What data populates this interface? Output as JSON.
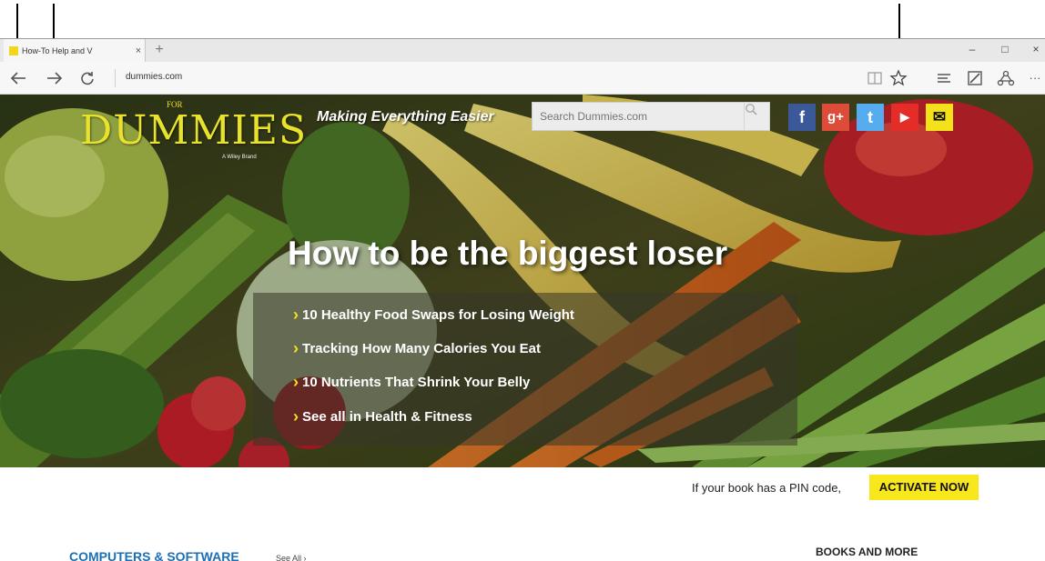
{
  "browser": {
    "tab_title": "How-To Help and V",
    "tab_close": "×",
    "new_tab": "+",
    "url": "dummies.com",
    "window_controls": [
      "–",
      "□",
      "×"
    ],
    "icons": [
      "back-icon",
      "forward-icon",
      "refresh-icon",
      "reading-view-icon",
      "favorites-star-icon",
      "hub-icon",
      "web-note-icon",
      "share-icon",
      "more-icon"
    ],
    "more_label": "···"
  },
  "site": {
    "logo_for": "FOR",
    "logo_main": "DUMMIES",
    "logo_wiley": "A Wiley Brand",
    "tagline": "Making Everything Easier",
    "search_placeholder": "Search Dummies.com",
    "social": [
      "f",
      "g+",
      "t",
      "▶",
      "✉"
    ],
    "social_names": [
      "facebook",
      "google-plus",
      "twitter",
      "youtube",
      "email"
    ]
  },
  "hero": {
    "headline": "How to be the biggest loser",
    "links": [
      "10 Healthy Food Swaps for Losing Weight",
      "Tracking How Many Calories You Eat",
      "10 Nutrients That Shrink Your Belly",
      "See all in Health & Fitness"
    ]
  },
  "pin": {
    "text": "If your book has a PIN code,",
    "button": "ACTIVATE NOW"
  },
  "sections": {
    "category_title": "COMPUTERS & SOFTWARE",
    "see_all": "See All ›",
    "books_title": "BOOKS AND MORE"
  },
  "colors": {
    "accent_yellow": "#f8e71c",
    "category_blue": "#1c6fb3",
    "facebook": "#3b5998",
    "google_plus": "#dd4b39",
    "twitter": "#55acee",
    "youtube": "#e52d27"
  }
}
